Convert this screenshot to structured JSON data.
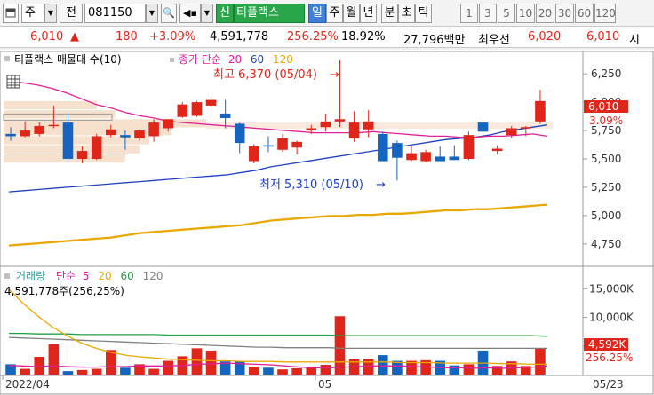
{
  "toolbar": {
    "market_select": "주",
    "jeon_button": "전",
    "code": "081150",
    "stock_name": "티플랙스",
    "period_tabs": [
      "일",
      "주",
      "월",
      "년",
      "분",
      "초",
      "틱"
    ],
    "interval_buttons": [
      "1",
      "3",
      "5",
      "10",
      "20",
      "30",
      "60",
      "120"
    ]
  },
  "quote": {
    "price": "6,010",
    "change": "180",
    "change_pct": "+3.09%",
    "volume": "4,591,778",
    "volume_ratio": "256.25%",
    "turnover": "18.92%",
    "amount": "27,796백만",
    "bid_label": "최우선",
    "bid_price": "6,020",
    "ask_price": "6,010",
    "trailing_label": "시"
  },
  "price_chart": {
    "header_title": "티플랙스 매물대 수(10)",
    "ma_labels": [
      {
        "text": "종가 단순",
        "color": "#e0209a"
      },
      {
        "text": "20",
        "color": "#e0209a"
      },
      {
        "text": "60",
        "color": "#2040c0"
      },
      {
        "text": "120",
        "color": "#e8a800"
      }
    ],
    "annotation_high": "최고 6,370 (05/04)",
    "annotation_low": "최저 5,310 (05/10)",
    "y_ticks": [
      "6,250",
      "6,000",
      "5,750",
      "5,500",
      "5,250",
      "5,000",
      "4,750"
    ],
    "current_price_tag": "6,010",
    "current_pct_tag": "3.09%"
  },
  "volume_chart": {
    "header_title": "거래량",
    "ma_labels": [
      {
        "text": "단순",
        "color": "#e0209a"
      },
      {
        "text": "5",
        "color": "#e0209a"
      },
      {
        "text": "20",
        "color": "#e8a800"
      },
      {
        "text": "60",
        "color": "#20a040"
      },
      {
        "text": "120",
        "color": "#808080"
      }
    ],
    "subtitle": "4,591,778주(256,25%)",
    "y_ticks": [
      "15,000K",
      "10,000K",
      "5,000K"
    ],
    "current_tag": "4,592K",
    "current_pct_tag": "256.25%"
  },
  "x_axis": {
    "labels": [
      "2022/04",
      "05",
      "05/23"
    ]
  },
  "chart_data": [
    {
      "type": "candlestick",
      "ylim": [
        4600,
        6400
      ],
      "ma_periods": [
        20,
        60,
        120
      ],
      "candles": [
        {
          "o": 5720,
          "h": 5780,
          "l": 5660,
          "c": 5700
        },
        {
          "o": 5700,
          "h": 5830,
          "l": 5690,
          "c": 5750
        },
        {
          "o": 5720,
          "h": 5820,
          "l": 5700,
          "c": 5790
        },
        {
          "o": 5800,
          "h": 5970,
          "l": 5770,
          "c": 5800
        },
        {
          "o": 5820,
          "h": 5900,
          "l": 5480,
          "c": 5500
        },
        {
          "o": 5500,
          "h": 5610,
          "l": 5460,
          "c": 5570
        },
        {
          "o": 5500,
          "h": 5720,
          "l": 5490,
          "c": 5700
        },
        {
          "o": 5710,
          "h": 5800,
          "l": 5690,
          "c": 5760
        },
        {
          "o": 5710,
          "h": 5750,
          "l": 5580,
          "c": 5690
        },
        {
          "o": 5680,
          "h": 5760,
          "l": 5660,
          "c": 5750
        },
        {
          "o": 5700,
          "h": 5850,
          "l": 5650,
          "c": 5820
        },
        {
          "o": 5770,
          "h": 5850,
          "l": 5740,
          "c": 5850
        },
        {
          "o": 5870,
          "h": 6000,
          "l": 5860,
          "c": 5980
        },
        {
          "o": 5880,
          "h": 6010,
          "l": 5870,
          "c": 6000
        },
        {
          "o": 5970,
          "h": 6050,
          "l": 5850,
          "c": 6020
        },
        {
          "o": 5900,
          "h": 6020,
          "l": 5770,
          "c": 5860
        },
        {
          "o": 5810,
          "h": 5820,
          "l": 5550,
          "c": 5640
        },
        {
          "o": 5480,
          "h": 5630,
          "l": 5460,
          "c": 5610
        },
        {
          "o": 5620,
          "h": 5700,
          "l": 5560,
          "c": 5610
        },
        {
          "o": 5580,
          "h": 5720,
          "l": 5560,
          "c": 5680
        },
        {
          "o": 5600,
          "h": 5660,
          "l": 5540,
          "c": 5650
        },
        {
          "o": 5750,
          "h": 5800,
          "l": 5720,
          "c": 5770
        },
        {
          "o": 5780,
          "h": 5900,
          "l": 5740,
          "c": 5830
        },
        {
          "o": 5830,
          "h": 6370,
          "l": 5780,
          "c": 5850
        },
        {
          "o": 5680,
          "h": 5920,
          "l": 5650,
          "c": 5820
        },
        {
          "o": 5760,
          "h": 5930,
          "l": 5690,
          "c": 5830
        },
        {
          "o": 5720,
          "h": 5740,
          "l": 5480,
          "c": 5480
        },
        {
          "o": 5640,
          "h": 5660,
          "l": 5310,
          "c": 5510
        },
        {
          "o": 5490,
          "h": 5610,
          "l": 5480,
          "c": 5550
        },
        {
          "o": 5480,
          "h": 5580,
          "l": 5470,
          "c": 5560
        },
        {
          "o": 5520,
          "h": 5610,
          "l": 5500,
          "c": 5480
        },
        {
          "o": 5520,
          "h": 5620,
          "l": 5490,
          "c": 5490
        },
        {
          "o": 5500,
          "h": 5740,
          "l": 5490,
          "c": 5710
        },
        {
          "o": 5820,
          "h": 5840,
          "l": 5720,
          "c": 5740
        },
        {
          "o": 5570,
          "h": 5620,
          "l": 5540,
          "c": 5590
        },
        {
          "o": 5710,
          "h": 5790,
          "l": 5680,
          "c": 5770
        },
        {
          "o": 5780,
          "h": 5790,
          "l": 5700,
          "c": 5780
        },
        {
          "o": 5830,
          "h": 6110,
          "l": 5810,
          "c": 6010
        }
      ],
      "ma20": [
        6190,
        6170,
        6150,
        6120,
        6080,
        6030,
        5980,
        5950,
        5910,
        5880,
        5860,
        5830,
        5820,
        5810,
        5800,
        5790,
        5780,
        5770,
        5760,
        5750,
        5740,
        5730,
        5730,
        5730,
        5730,
        5740,
        5730,
        5720,
        5710,
        5700,
        5700,
        5690,
        5690,
        5700,
        5700,
        5710,
        5720,
        5700
      ],
      "ma60": [
        5210,
        5220,
        5230,
        5240,
        5250,
        5260,
        5270,
        5280,
        5290,
        5300,
        5310,
        5320,
        5330,
        5340,
        5350,
        5360,
        5380,
        5400,
        5430,
        5450,
        5470,
        5490,
        5510,
        5530,
        5550,
        5570,
        5590,
        5610,
        5630,
        5650,
        5670,
        5680,
        5690,
        5710,
        5740,
        5760,
        5780,
        5800
      ],
      "ma120": [
        4740,
        4750,
        4760,
        4770,
        4780,
        4790,
        4800,
        4810,
        4830,
        4850,
        4860,
        4870,
        4880,
        4890,
        4900,
        4910,
        4920,
        4940,
        4960,
        4970,
        4980,
        4990,
        5000,
        5000,
        5010,
        5010,
        5020,
        5020,
        5030,
        5040,
        5050,
        5050,
        5060,
        5060,
        5070,
        5080,
        5090,
        5100
      ],
      "volume_profile": [
        {
          "price": 5970,
          "weight": 0.46
        },
        {
          "price": 5890,
          "weight": 0.55
        },
        {
          "price": 5810,
          "weight": 1.0
        },
        {
          "price": 5740,
          "weight": 0.83
        },
        {
          "price": 5660,
          "weight": 0.72
        },
        {
          "price": 5580,
          "weight": 0.67
        },
        {
          "price": 5500,
          "weight": 0.6
        }
      ],
      "high": {
        "value": 6370,
        "date": "05/04"
      },
      "low": {
        "value": 5310,
        "date": "05/10"
      }
    },
    {
      "type": "bar",
      "name": "거래량",
      "unit": "K",
      "ylim": [
        0,
        18000
      ],
      "values": [
        1800,
        1000,
        3100,
        5300,
        600,
        800,
        1000,
        4300,
        1200,
        1800,
        1000,
        2400,
        3200,
        4600,
        4200,
        2300,
        2400,
        1400,
        1200,
        900,
        1100,
        1400,
        1700,
        10200,
        2700,
        2700,
        3400,
        2400,
        2400,
        2500,
        2400,
        1600,
        1800,
        4200,
        1500,
        2300,
        1500,
        4592
      ],
      "ma5": [
        1600,
        1500,
        1400,
        1500,
        1400,
        1300,
        1300,
        1400,
        1400,
        1500,
        1500,
        1500,
        1600,
        1800,
        1900,
        2000,
        1900,
        1800,
        1700,
        1500,
        1300,
        1200,
        1200,
        1300,
        1400,
        1500,
        1500,
        1500,
        1400,
        1300,
        1200,
        1200,
        1100,
        1200,
        1100,
        1200,
        1300,
        1500
      ],
      "ma20": [
        14900,
        12400,
        10200,
        8300,
        6800,
        5500,
        4600,
        3900,
        3400,
        3100,
        2900,
        2700,
        2600,
        2500,
        2400,
        2400,
        2300,
        2300,
        2300,
        2200,
        2200,
        2200,
        2200,
        2200,
        2200,
        2200,
        2200,
        2100,
        2100,
        2100,
        2000,
        2000,
        2000,
        2000,
        1900,
        1900,
        1800,
        1800
      ],
      "ma60": [
        7200,
        7200,
        7100,
        7100,
        7100,
        7000,
        7000,
        7000,
        7000,
        7000,
        7000,
        6900,
        6900,
        6900,
        6900,
        6900,
        6900,
        6900,
        6900,
        6900,
        6900,
        6900,
        6900,
        6800,
        6800,
        6800,
        6800,
        6800,
        6800,
        6800,
        6800,
        6800,
        6800,
        6800,
        6800,
        6800,
        6800,
        6700
      ],
      "ma120": [
        6500,
        6400,
        6300,
        6200,
        6100,
        6000,
        5900,
        5800,
        5700,
        5600,
        5500,
        5400,
        5300,
        5200,
        5100,
        5000,
        4900,
        4800,
        4800,
        4700,
        4700,
        4700,
        4700,
        4600,
        4600,
        4600,
        4600,
        4600,
        4600,
        4600,
        4600,
        4600,
        4600,
        4600,
        4600,
        4600,
        4600,
        4600
      ]
    }
  ]
}
